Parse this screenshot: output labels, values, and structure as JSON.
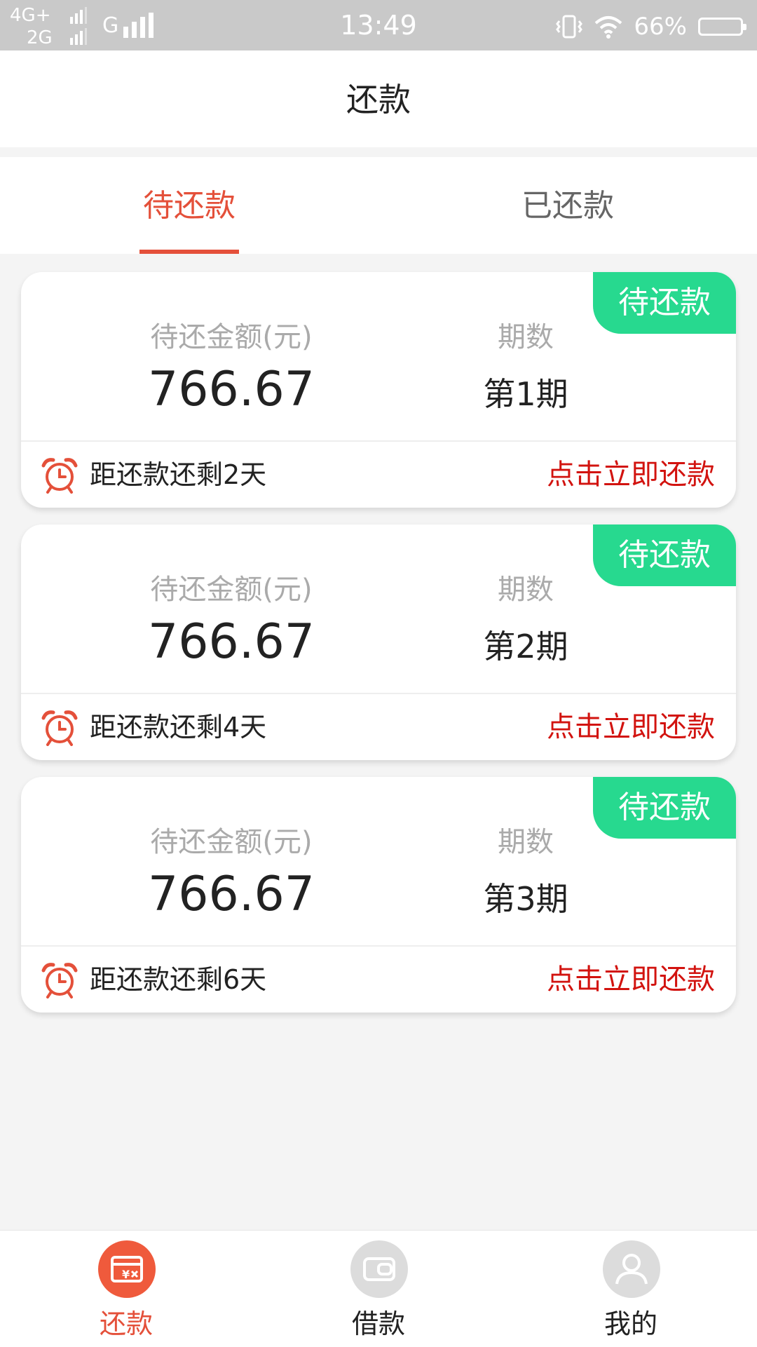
{
  "status_bar": {
    "network_1": "4G+",
    "network_2": "2G",
    "carrier_g": "G",
    "time": "13:49",
    "battery_percent": "66%"
  },
  "header": {
    "title": "还款"
  },
  "tabs": [
    {
      "label": "待还款",
      "active": true
    },
    {
      "label": "已还款",
      "active": false
    }
  ],
  "cards": [
    {
      "badge": "待还款",
      "amount_label": "待还金额(元)",
      "amount": "766.67",
      "period_label": "期数",
      "period": "第1期",
      "countdown": "距还款还剩2天",
      "action": "点击立即还款"
    },
    {
      "badge": "待还款",
      "amount_label": "待还金额(元)",
      "amount": "766.67",
      "period_label": "期数",
      "period": "第2期",
      "countdown": "距还款还剩4天",
      "action": "点击立即还款"
    },
    {
      "badge": "待还款",
      "amount_label": "待还金额(元)",
      "amount": "766.67",
      "period_label": "期数",
      "period": "第3期",
      "countdown": "距还款还剩6天",
      "action": "点击立即还款"
    }
  ],
  "bottom_nav": [
    {
      "label": "还款",
      "icon": "repay-icon",
      "active": true
    },
    {
      "label": "借款",
      "icon": "wallet-icon",
      "active": false
    },
    {
      "label": "我的",
      "icon": "user-icon",
      "active": false
    }
  ],
  "colors": {
    "accent": "#e4503a",
    "badge_green": "#27d98f",
    "action_red": "#d2130f",
    "nav_inactive": "#dcdcdc"
  }
}
